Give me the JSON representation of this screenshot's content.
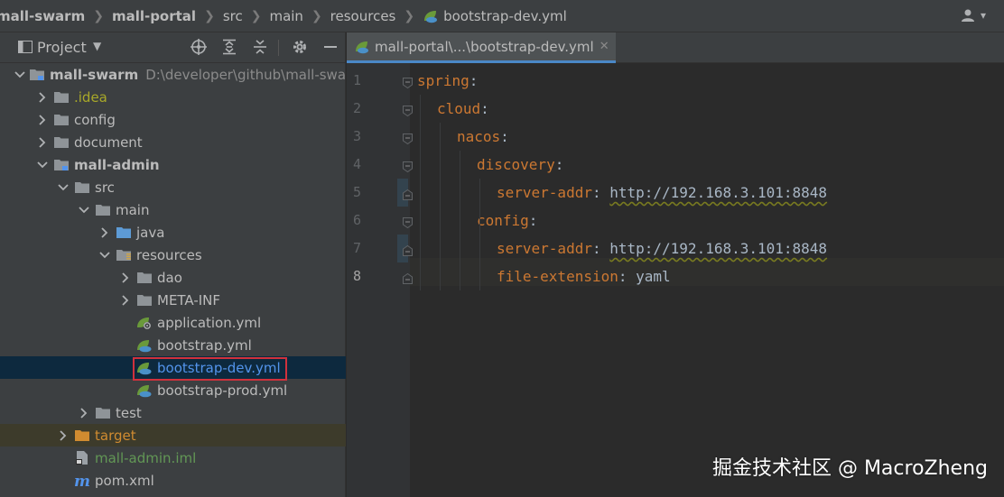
{
  "breadcrumb": [
    "mall-swarm",
    "mall-portal",
    "src",
    "main",
    "resources",
    "bootstrap-dev.yml"
  ],
  "project_panel": {
    "title": "Project"
  },
  "tree": [
    {
      "label": "mall-swarm",
      "path": "D:\\developer\\github\\mall-swarm",
      "depth": 0,
      "expanded": true,
      "icon": "module-folder-icon"
    },
    {
      "label": ".idea",
      "depth": 1,
      "expanded": false,
      "icon": "folder-icon"
    },
    {
      "label": "config",
      "depth": 1,
      "expanded": false,
      "icon": "folder-icon"
    },
    {
      "label": "document",
      "depth": 1,
      "expanded": false,
      "icon": "folder-icon"
    },
    {
      "label": "mall-admin",
      "depth": 1,
      "expanded": true,
      "icon": "module-folder-icon"
    },
    {
      "label": "src",
      "depth": 2,
      "expanded": true,
      "icon": "folder-icon"
    },
    {
      "label": "main",
      "depth": 3,
      "expanded": true,
      "icon": "folder-icon"
    },
    {
      "label": "java",
      "depth": 4,
      "expanded": false,
      "icon": "source-folder-icon"
    },
    {
      "label": "resources",
      "depth": 4,
      "expanded": true,
      "icon": "resources-folder-icon"
    },
    {
      "label": "dao",
      "depth": 5,
      "expanded": false,
      "icon": "folder-icon"
    },
    {
      "label": "META-INF",
      "depth": 5,
      "expanded": false,
      "icon": "folder-icon"
    },
    {
      "label": "application.yml",
      "depth": 5,
      "icon": "spring-yml-icon"
    },
    {
      "label": "bootstrap.yml",
      "depth": 5,
      "icon": "spring-cloud-yml-icon"
    },
    {
      "label": "bootstrap-dev.yml",
      "depth": 5,
      "icon": "spring-cloud-yml-icon",
      "selected": true
    },
    {
      "label": "bootstrap-prod.yml",
      "depth": 5,
      "icon": "spring-cloud-yml-icon"
    },
    {
      "label": "test",
      "depth": 3,
      "expanded": false,
      "icon": "folder-icon"
    },
    {
      "label": "target",
      "depth": 2,
      "expanded": false,
      "icon": "excluded-folder-icon"
    },
    {
      "label": "mall-admin.iml",
      "depth": 2,
      "icon": "iml-file-icon"
    },
    {
      "label": "pom.xml",
      "depth": 2,
      "icon": "maven-icon"
    }
  ],
  "editor": {
    "tab_label": "mall-portal\\...\\bootstrap-dev.yml",
    "lines": [
      {
        "n": "1",
        "indent": 0,
        "key": "spring",
        "sep": ":",
        "value": ""
      },
      {
        "n": "2",
        "indent": 1,
        "key": "cloud",
        "sep": ":",
        "value": ""
      },
      {
        "n": "3",
        "indent": 2,
        "key": "nacos",
        "sep": ":",
        "value": ""
      },
      {
        "n": "4",
        "indent": 3,
        "key": "discovery",
        "sep": ":",
        "value": ""
      },
      {
        "n": "5",
        "indent": 4,
        "key": "server-addr",
        "sep": ": ",
        "value": "http://192.168.3.101:8848"
      },
      {
        "n": "6",
        "indent": 3,
        "key": "config",
        "sep": ":",
        "value": ""
      },
      {
        "n": "7",
        "indent": 4,
        "key": "server-addr",
        "sep": ": ",
        "value": "http://192.168.3.101:8848"
      },
      {
        "n": "8",
        "indent": 4,
        "key": "file-extension",
        "sep": ": ",
        "value": "yaml"
      }
    ]
  },
  "watermark": "掘金技术社区 @ MacroZheng",
  "colors": {
    "keyword": "#cc7832",
    "text": "#a9b7c6",
    "selection": "#0d293e",
    "highlight_box": "#d0313c"
  }
}
